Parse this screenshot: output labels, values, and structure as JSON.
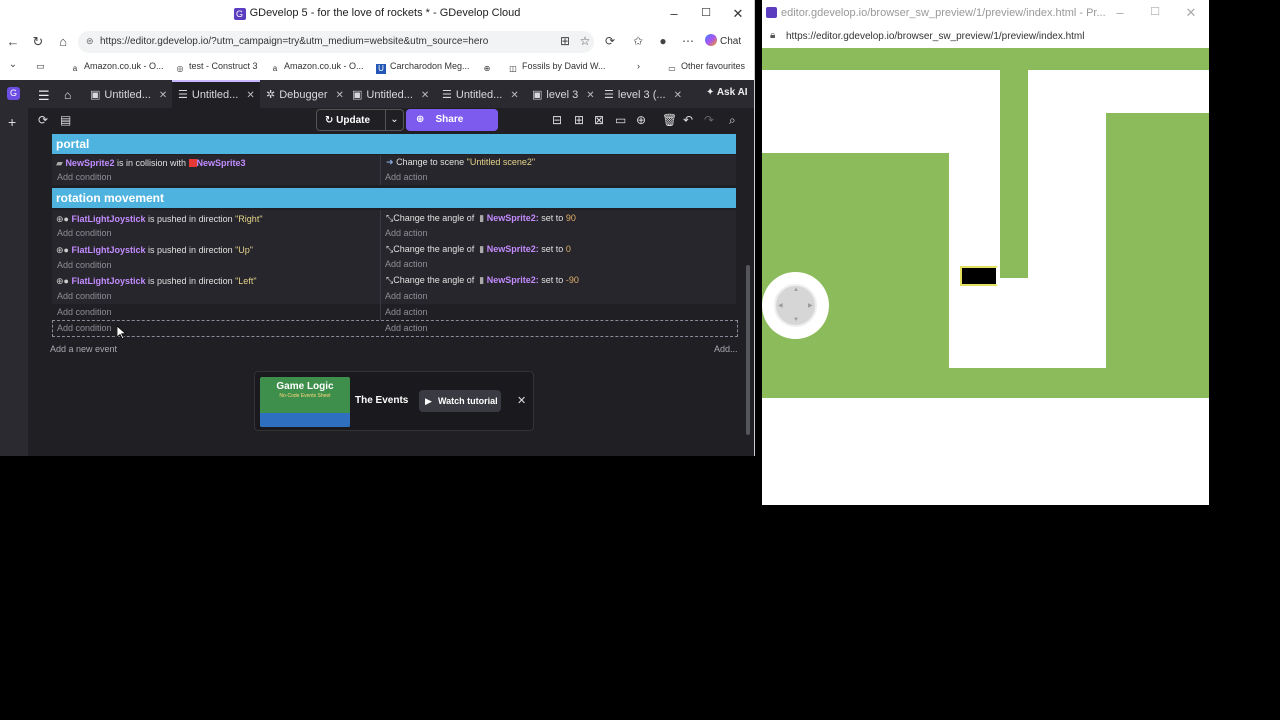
{
  "left_window": {
    "title": "GDevelop 5 - for the love of rockets * - GDevelop Cloud",
    "url": "https://editor.gdevelop.io/?utm_campaign=try&utm_medium=website&utm_source=hero",
    "chat_label": "Chat",
    "bookmarks": [
      "Amazon.co.uk - O...",
      "test - Construct 3",
      "Amazon.co.uk - O...",
      "Carcharodon Meg...",
      "Fossils by David W...",
      "Other favourites"
    ]
  },
  "gdevelop": {
    "tabs": [
      {
        "label": "Untitled...",
        "icon": "scene-icon"
      },
      {
        "label": "Untitled...",
        "icon": "events-icon"
      },
      {
        "label": "Debugger",
        "icon": "debugger-icon"
      },
      {
        "label": "Untitled...",
        "icon": "scene-icon"
      },
      {
        "label": "Untitled...",
        "icon": "events-icon"
      },
      {
        "label": "level 3",
        "icon": "scene-icon"
      },
      {
        "label": "level 3 (...",
        "icon": "events-icon"
      }
    ],
    "ask_ai": "Ask AI",
    "update_label": "Update",
    "share_label": "Share",
    "groups": {
      "portal": "portal",
      "rotation": "rotation movement"
    },
    "portal_event": {
      "obj1": "NewSprite2",
      "is_in_collision": "is in collision with",
      "obj2": "NewSprite3",
      "action_prefix": "Change to scene",
      "scene": "\"Untitled scene2\""
    },
    "rotation_events": [
      {
        "obj": "FlatLightJoystick",
        "cond": "is pushed in direction",
        "dir": "\"Right\"",
        "action": "Change the angle of",
        "target": "NewSprite2:",
        "set_to": "set to",
        "value": "90"
      },
      {
        "obj": "FlatLightJoystick",
        "cond": "is pushed in direction",
        "dir": "\"Up\"",
        "action": "Change the angle of",
        "target": "NewSprite2:",
        "set_to": "set to",
        "value": "0"
      },
      {
        "obj": "FlatLightJoystick",
        "cond": "is pushed in direction",
        "dir": "\"Left\"",
        "action": "Change the angle of",
        "target": "NewSprite2:",
        "set_to": "set to",
        "value": "-90"
      }
    ],
    "add_condition": "Add condition",
    "add_action": "Add action",
    "add_new_event": "Add a new event",
    "add": "Add...",
    "tip": {
      "thumb_title": "Game Logic",
      "thumb_sub": "No-Code Events Sheet",
      "label": "The Events",
      "watch": "Watch tutorial"
    }
  },
  "right_window": {
    "title": "editor.gdevelop.io/browser_sw_preview/1/preview/index.html - Pr...",
    "url": "https://editor.gdevelop.io/browser_sw_preview/1/preview/index.html"
  },
  "colors": {
    "group_header": "#4fb3e0",
    "object_name": "#c38cff",
    "grass": "#8cbb5b",
    "share": "#7e5bef"
  }
}
